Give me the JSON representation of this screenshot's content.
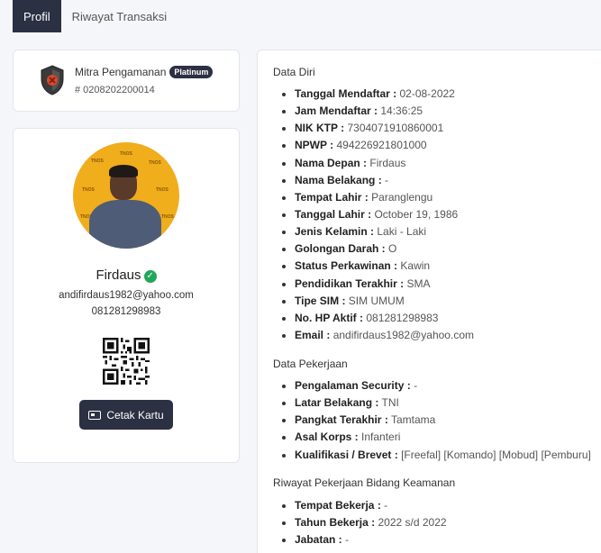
{
  "tabs": [
    {
      "label": "Profil",
      "active": true
    },
    {
      "label": "Riwayat Transaksi",
      "active": false
    }
  ],
  "mitra": {
    "title": "Mitra Pengamanan",
    "badge": "Platinum",
    "id": "# 0208202200014"
  },
  "profile": {
    "name": "Firdaus",
    "verified_icon": "check-circle-icon",
    "email": "andifirdaus1982@yahoo.com",
    "phone": "081281298983",
    "print_button": "Cetak Kartu",
    "print_icon": "id-card-icon"
  },
  "data_diri": {
    "title": "Data Diri",
    "items": [
      {
        "label": "Tanggal Mendaftar :",
        "value": "02-08-2022"
      },
      {
        "label": "Jam Mendaftar :",
        "value": "14:36:25"
      },
      {
        "label": "NIK KTP :",
        "value": "7304071910860001"
      },
      {
        "label": "NPWP :",
        "value": "494226921801000"
      },
      {
        "label": "Nama Depan :",
        "value": "Firdaus"
      },
      {
        "label": "Nama Belakang :",
        "value": "-"
      },
      {
        "label": "Tempat Lahir :",
        "value": "Paranglengu"
      },
      {
        "label": "Tanggal Lahir :",
        "value": "October 19, 1986"
      },
      {
        "label": "Jenis Kelamin :",
        "value": "Laki - Laki"
      },
      {
        "label": "Golongan Darah :",
        "value": "O"
      },
      {
        "label": "Status Perkawinan :",
        "value": "Kawin"
      },
      {
        "label": "Pendidikan Terakhir :",
        "value": "SMA"
      },
      {
        "label": "Tipe SIM :",
        "value": "SIM UMUM"
      },
      {
        "label": "No. HP Aktif :",
        "value": "081281298983"
      },
      {
        "label": "Email :",
        "value": "andifirdaus1982@yahoo.com"
      }
    ]
  },
  "data_pekerjaan": {
    "title": "Data Pekerjaan",
    "items": [
      {
        "label": "Pengalaman Security :",
        "value": "-"
      },
      {
        "label": "Latar Belakang :",
        "value": "TNI"
      },
      {
        "label": "Pangkat Terakhir :",
        "value": "Tamtama"
      },
      {
        "label": "Asal Korps :",
        "value": "Infanteri"
      },
      {
        "label": "Kualifikasi / Brevet :",
        "value": "[Freefal] [Komando] [Mobud] [Pemburu]"
      }
    ]
  },
  "riwayat": {
    "title": "Riwayat Pekerjaan Bidang Keamanan",
    "items": [
      {
        "label": "Tempat Bekerja :",
        "value": "-"
      },
      {
        "label": "Tahun Bekerja :",
        "value": "2022 s/d 2022"
      },
      {
        "label": "Jabatan :",
        "value": "-"
      }
    ]
  }
}
